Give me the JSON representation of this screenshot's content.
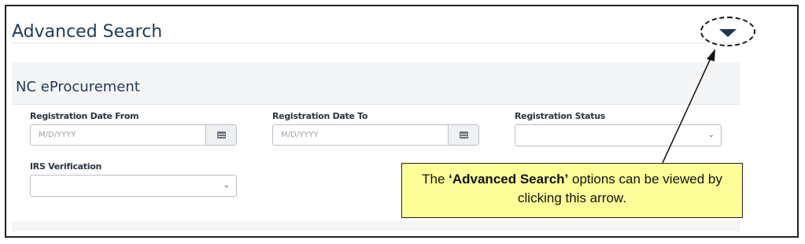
{
  "header": {
    "title": "Advanced Search",
    "toggle_icon": "caret-down-icon"
  },
  "section": {
    "title": "NC eProcurement"
  },
  "fields": {
    "registration_date_from": {
      "label": "Registration Date From",
      "placeholder": "M/D/YYYY",
      "icon": "calendar-icon"
    },
    "registration_date_to": {
      "label": "Registration Date To",
      "placeholder": "M/D/YYYY",
      "icon": "calendar-icon"
    },
    "registration_status": {
      "label": "Registration Status",
      "value": ""
    },
    "irs_verification": {
      "label": "IRS Verification",
      "value": ""
    }
  },
  "callout": {
    "text_before": "The ",
    "text_bold": "‘Advanced Search’",
    "text_after": " options can be viewed by clicking this arrow."
  },
  "colors": {
    "callout_bg": "#ffff99",
    "title_color": "#1f3a5a",
    "caret_color": "#1e3558"
  }
}
